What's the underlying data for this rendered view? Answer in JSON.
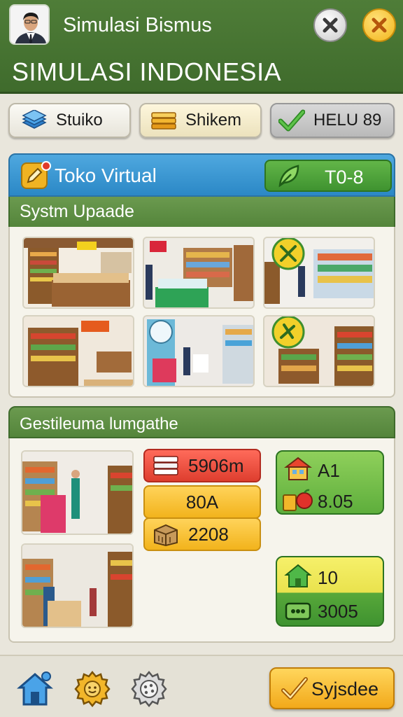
{
  "header": {
    "app_title": "Simulasi Bismus",
    "page_title": "SIMULASI INDONESIA"
  },
  "tabs": [
    {
      "label": "Stuiko",
      "icon": "layers-icon"
    },
    {
      "label": "Shikem",
      "icon": "stack-icon"
    },
    {
      "label": "HELU 89",
      "icon": "checkmark-icon"
    }
  ],
  "store": {
    "title": "Toko Virtual",
    "code_label": "T0-8",
    "section_title": "Systm Upaade"
  },
  "management": {
    "section_title": "Gestileuma lumgathe",
    "stats": [
      {
        "value": "5906m",
        "icon": "stack-icon"
      },
      {
        "value": "80A"
      },
      {
        "value": "2208",
        "icon": "box-icon"
      }
    ],
    "cards": [
      {
        "label": "A1",
        "value": "8.05"
      },
      {
        "label": "10",
        "value": "3005"
      }
    ]
  },
  "bottom_bar": {
    "action_label": "Syjsdee"
  },
  "colors": {
    "header_green": "#4f7d38",
    "banner_blue": "#2b88c6",
    "accent_yellow": "#f2b31c",
    "alert_red": "#de3e2f"
  }
}
